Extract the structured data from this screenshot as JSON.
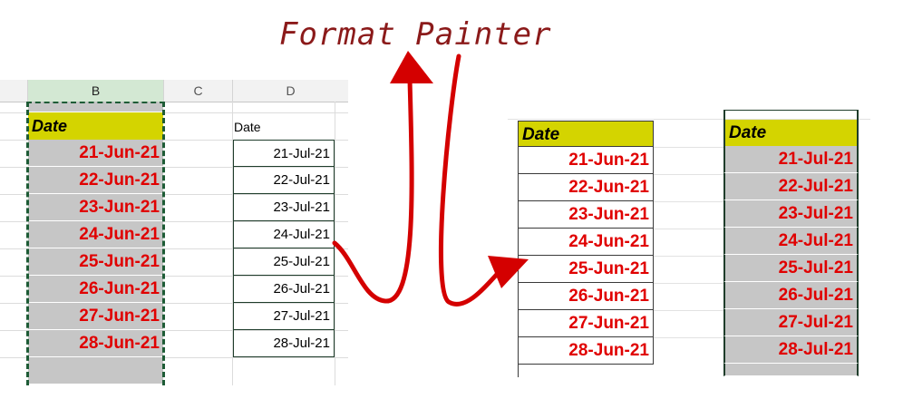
{
  "title": "Format Painter",
  "colors": {
    "title": "#8b1a1a",
    "arrow": "#d40000",
    "header_fill": "#d4d400",
    "selected_fill": "#c6c6c6",
    "date_red": "#e00000"
  },
  "spreadsheet": {
    "columns": [
      "B",
      "C",
      "D"
    ],
    "source": {
      "header": "Date",
      "values": [
        "21-Jun-21",
        "22-Jun-21",
        "23-Jun-21",
        "24-Jun-21",
        "25-Jun-21",
        "26-Jun-21",
        "27-Jun-21",
        "28-Jun-21"
      ]
    },
    "target": {
      "header": "Date",
      "values": [
        "21-Jul-21",
        "22-Jul-21",
        "23-Jul-21",
        "24-Jul-21",
        "25-Jul-21",
        "26-Jul-21",
        "27-Jul-21",
        "28-Jul-21"
      ]
    }
  },
  "result": {
    "left": {
      "header": "Date",
      "values": [
        "21-Jun-21",
        "22-Jun-21",
        "23-Jun-21",
        "24-Jun-21",
        "25-Jun-21",
        "26-Jun-21",
        "27-Jun-21",
        "28-Jun-21"
      ]
    },
    "right": {
      "header": "Date",
      "values": [
        "21-Jul-21",
        "22-Jul-21",
        "23-Jul-21",
        "24-Jul-21",
        "25-Jul-21",
        "26-Jul-21",
        "27-Jul-21",
        "28-Jul-21"
      ]
    }
  }
}
